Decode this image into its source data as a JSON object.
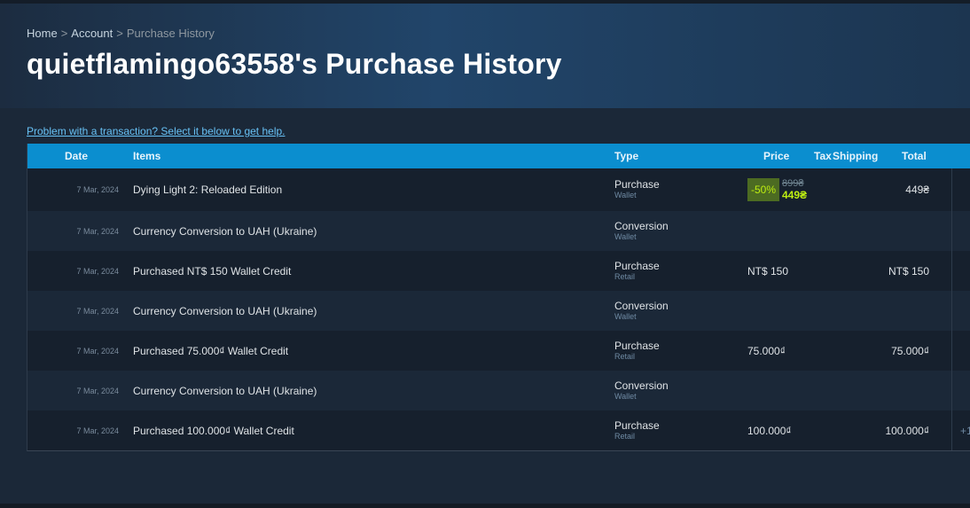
{
  "breadcrumb": {
    "home": "Home",
    "sep1": ">",
    "account": "Account",
    "sep2": ">",
    "current": "Purchase History"
  },
  "title": "quietflamingo63558's Purchase History",
  "help_text": "Problem with a transaction? Select it below to get help.",
  "columns": {
    "date": "Date",
    "items": "Items",
    "type": "Type",
    "price": "Price",
    "tax": "Tax",
    "shipping": "Shipping",
    "total": "Total"
  },
  "rows": [
    {
      "date": "7 Mar, 2024",
      "item": "Dying Light 2: Reloaded Edition",
      "type": "Purchase",
      "method": "Wallet",
      "discount": {
        "pct": "-50%",
        "original": "899₴",
        "final": "449₴"
      },
      "total": "449₴"
    },
    {
      "date": "7 Mar, 2024",
      "item": "Currency Conversion to UAH (Ukraine)",
      "type": "Conversion",
      "method": "Wallet"
    },
    {
      "date": "7 Mar, 2024",
      "item": "Purchased NT$ 150 Wallet Credit",
      "type": "Purchase",
      "method": "Retail",
      "price": "NT$ 150",
      "total": "NT$ 150"
    },
    {
      "date": "7 Mar, 2024",
      "item": "Currency Conversion to UAH (Ukraine)",
      "type": "Conversion",
      "method": "Wallet"
    },
    {
      "date": "7 Mar, 2024",
      "item": "Purchased 75.000₫ Wallet Credit",
      "type": "Purchase",
      "method": "Retail",
      "price": "75.000₫",
      "total": "75.000₫"
    },
    {
      "date": "7 Mar, 2024",
      "item": "Currency Conversion to UAH (Ukraine)",
      "type": "Conversion",
      "method": "Wallet"
    },
    {
      "date": "7 Mar, 2024",
      "item": "Purchased 100.000₫ Wallet Credit",
      "type": "Purchase",
      "method": "Retail",
      "price": "100.000₫",
      "total": "100.000₫",
      "extra": "+1"
    }
  ],
  "colors": {
    "background": "#1b2838",
    "header": "#0b8ecf",
    "link": "#67c1f5",
    "discount_bg": "#4c6b22",
    "discount_text": "#beee11"
  }
}
